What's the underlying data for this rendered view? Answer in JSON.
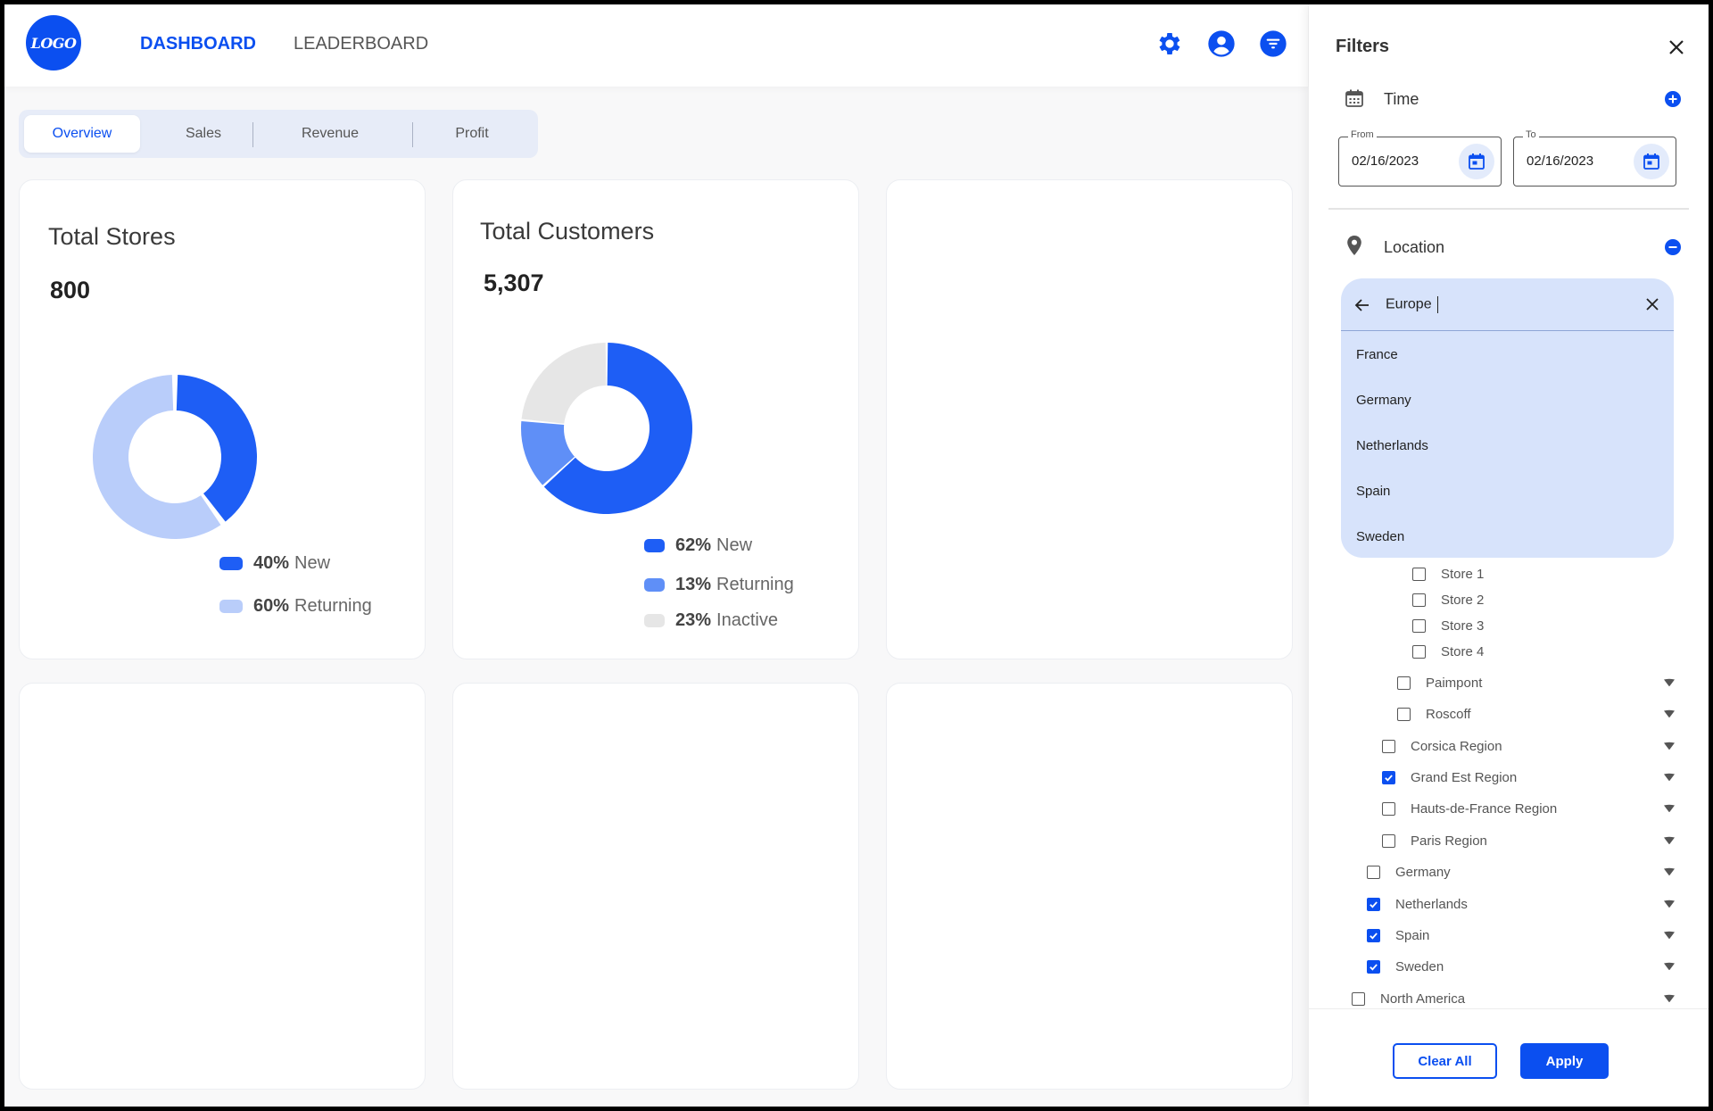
{
  "header": {
    "logo_text": "LOGO",
    "nav": [
      "DASHBOARD",
      "LEADERBOARD"
    ],
    "icons": [
      "gear-icon",
      "user-account-icon",
      "filter-icon"
    ]
  },
  "tabs": [
    "Overview",
    "Sales",
    "Revenue",
    "Profit"
  ],
  "cards": {
    "stores": {
      "title": "Total Stores",
      "value": "800",
      "legend": [
        {
          "pct": "40%",
          "label": "New",
          "color": "#1e5ef5"
        },
        {
          "pct": "60%",
          "label": "Returning",
          "color": "#b9cdfa"
        }
      ]
    },
    "customers": {
      "title": "Total Customers",
      "value": "5,307",
      "legend": [
        {
          "pct": "62%",
          "label": "New",
          "color": "#1e5ef5"
        },
        {
          "pct": "13%",
          "label": "Returning",
          "color": "#5f8ff7"
        },
        {
          "pct": "23%",
          "label": "Inactive",
          "color": "#e6e6e6"
        }
      ]
    }
  },
  "chart_data": [
    {
      "type": "pie",
      "title": "Total Stores",
      "categories": [
        "New",
        "Returning"
      ],
      "values": [
        40,
        60
      ],
      "colors": [
        "#1e5ef5",
        "#b9cdfa"
      ]
    },
    {
      "type": "pie",
      "title": "Total Customers",
      "categories": [
        "New",
        "Returning",
        "Inactive"
      ],
      "values": [
        62,
        13,
        23
      ],
      "colors": [
        "#1e5ef5",
        "#5f8ff7",
        "#e6e6e6"
      ]
    }
  ],
  "filters": {
    "title": "Filters",
    "time": {
      "label": "Time",
      "from_label": "From",
      "from_value": "02/16/2023",
      "to_label": "To",
      "to_value": "02/16/2023"
    },
    "location": {
      "label": "Location",
      "search_value": "Europe",
      "options": [
        "France",
        "Germany",
        "Netherlands",
        "Spain",
        "Sweden"
      ],
      "tree": [
        {
          "label": "Store 1",
          "checked": false,
          "expandable": false
        },
        {
          "label": "Store 2",
          "checked": false,
          "expandable": false
        },
        {
          "label": "Store 3",
          "checked": false,
          "expandable": false
        },
        {
          "label": "Store 4",
          "checked": false,
          "expandable": false
        },
        {
          "label": "Paimpont",
          "checked": false,
          "expandable": true
        },
        {
          "label": "Roscoff",
          "checked": false,
          "expandable": true
        },
        {
          "label": "Corsica Region",
          "checked": false,
          "expandable": true
        },
        {
          "label": "Grand Est Region",
          "checked": true,
          "expandable": true
        },
        {
          "label": "Hauts-de-France Region",
          "checked": false,
          "expandable": true
        },
        {
          "label": "Paris Region",
          "checked": false,
          "expandable": true
        },
        {
          "label": "Germany",
          "checked": false,
          "expandable": true
        },
        {
          "label": "Netherlands",
          "checked": true,
          "expandable": true
        },
        {
          "label": "Spain",
          "checked": true,
          "expandable": true
        },
        {
          "label": "Sweden",
          "checked": true,
          "expandable": true
        },
        {
          "label": "North America",
          "checked": false,
          "expandable": true
        }
      ]
    },
    "buttons": {
      "clear": "Clear All",
      "apply": "Apply"
    }
  },
  "colors": {
    "accent": "#0b4ff0",
    "dropdown_bg": "#d7e3fb"
  }
}
